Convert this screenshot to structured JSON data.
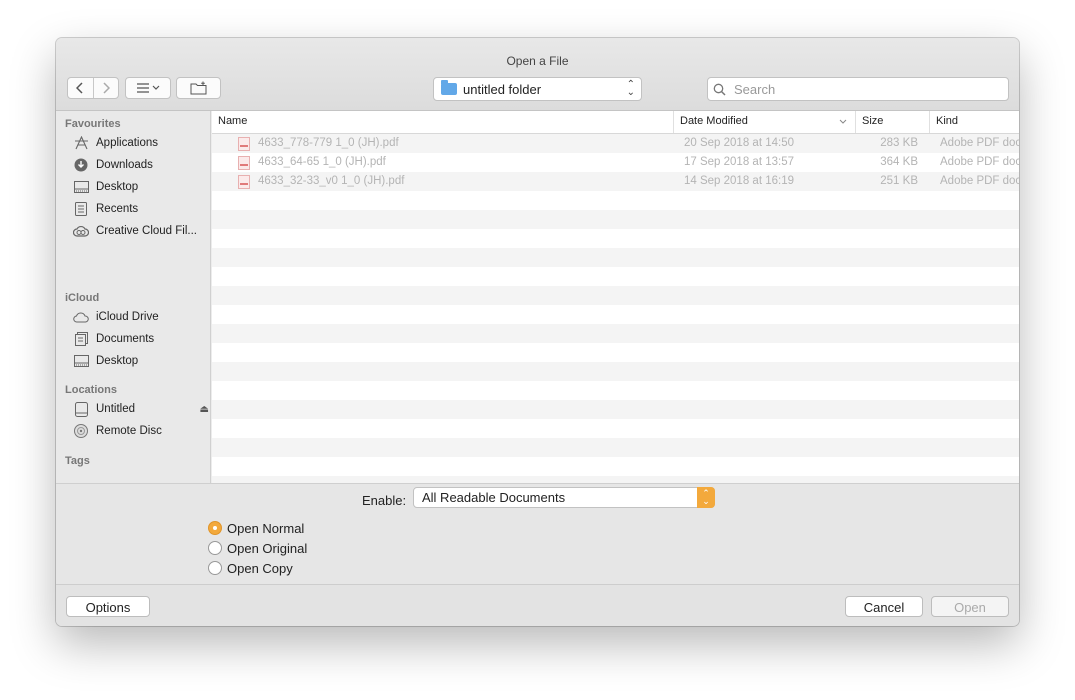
{
  "window": {
    "title": "Open a File"
  },
  "toolbar": {
    "location": "untitled folder",
    "search_placeholder": "Search"
  },
  "sidebar": {
    "sections": [
      {
        "header": "Favourites",
        "items": [
          {
            "label": "Applications",
            "icon": "applications-icon"
          },
          {
            "label": "Downloads",
            "icon": "downloads-icon"
          },
          {
            "label": "Desktop",
            "icon": "desktop-icon"
          },
          {
            "label": "Recents",
            "icon": "recents-icon"
          },
          {
            "label": "Creative Cloud Fil...",
            "icon": "creative-cloud-icon"
          }
        ]
      },
      {
        "header": "iCloud",
        "items": [
          {
            "label": "iCloud Drive",
            "icon": "cloud-icon"
          },
          {
            "label": "Documents",
            "icon": "documents-icon"
          },
          {
            "label": "Desktop",
            "icon": "desktop-icon"
          }
        ]
      },
      {
        "header": "Locations",
        "items": [
          {
            "label": "Untitled",
            "icon": "drive-icon"
          },
          {
            "label": "Remote Disc",
            "icon": "disc-icon"
          }
        ]
      },
      {
        "header": "Tags",
        "items": []
      }
    ]
  },
  "columns": {
    "name": "Name",
    "date": "Date Modified",
    "size": "Size",
    "kind": "Kind"
  },
  "files": [
    {
      "name": "4633_778-779 1_0 (JH).pdf",
      "date": "20 Sep 2018 at 14:50",
      "size": "283 KB",
      "kind": "Adobe PDF document"
    },
    {
      "name": "4633_64-65 1_0 (JH).pdf",
      "date": "17 Sep 2018 at 13:57",
      "size": "364 KB",
      "kind": "Adobe PDF document"
    },
    {
      "name": "4633_32-33_v0 1_0 (JH).pdf",
      "date": "14 Sep 2018 at 16:19",
      "size": "251 KB",
      "kind": "Adobe PDF document"
    }
  ],
  "options": {
    "enable_label": "Enable:",
    "enable_value": "All Readable Documents",
    "radios": [
      {
        "label": "Open Normal",
        "selected": true
      },
      {
        "label": "Open Original",
        "selected": false
      },
      {
        "label": "Open Copy",
        "selected": false
      }
    ]
  },
  "footer": {
    "options": "Options",
    "cancel": "Cancel",
    "open": "Open"
  },
  "colors": {
    "accent": "#f3a93c",
    "folder": "#62a8e8"
  }
}
